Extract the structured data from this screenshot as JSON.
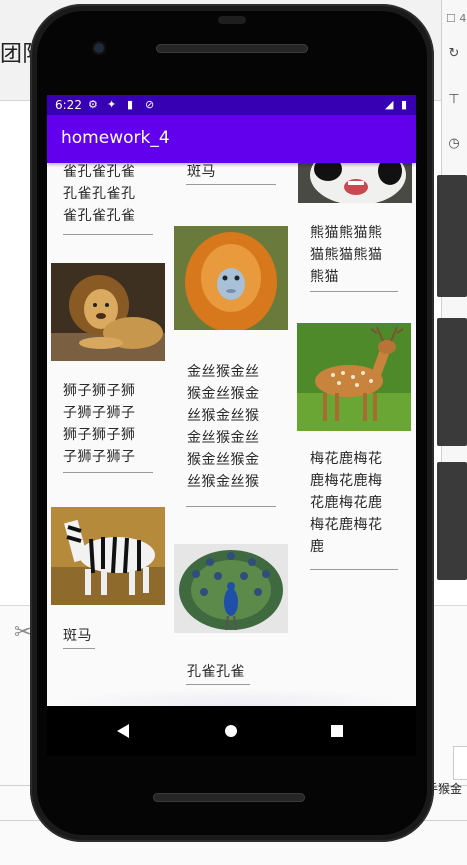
{
  "ide": {
    "left_text": "团队",
    "pin": "☐ 4",
    "bottom_text": "手猴金"
  },
  "status": {
    "time": "6:22"
  },
  "app": {
    "title": "homework_4"
  },
  "grid": {
    "col1": [
      {
        "caption": "雀孔雀孔雀\n孔雀孔雀孔\n雀孔雀孔雀"
      },
      {
        "caption": "狮子狮子狮\n子狮子狮子\n狮子狮子狮\n子狮子狮子",
        "image": "lion-photo"
      },
      {
        "caption": "斑马",
        "image": "zebra-photo"
      }
    ],
    "col2": [
      {
        "caption": "斑马"
      },
      {
        "caption": "金丝猴金丝\n猴金丝猴金\n丝猴金丝猴\n金丝猴金丝\n猴金丝猴金\n丝猴金丝猴",
        "image": "golden-monkey-photo"
      },
      {
        "caption": "孔雀孔雀",
        "image": "peacock-photo"
      }
    ],
    "col3": [
      {
        "caption": "熊猫熊猫熊\n猫熊猫熊猫\n熊猫",
        "image": "panda-photo"
      },
      {
        "caption": "梅花鹿梅花\n鹿梅花鹿梅\n花鹿梅花鹿\n梅花鹿梅花\n鹿",
        "image": "deer-photo"
      }
    ]
  }
}
